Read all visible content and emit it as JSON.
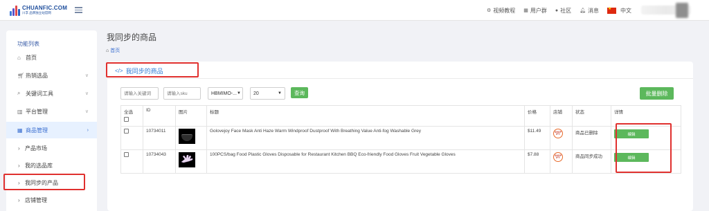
{
  "topbar": {
    "logo_name": "CHUANFIC.COM",
    "logo_tagline": "川孚 品牌独立站官网",
    "links": [
      {
        "label": "视频教程",
        "icon": "settings-icon"
      },
      {
        "label": "用户群",
        "icon": "grid-icon"
      },
      {
        "label": "社区",
        "icon": "user-icon"
      },
      {
        "label": "消息",
        "icon": "bell-icon"
      }
    ],
    "language": "中文"
  },
  "sidebar": {
    "title": "功能列表",
    "items": [
      {
        "label": "首页",
        "icon": "home-icon"
      },
      {
        "label": "热销选品",
        "icon": "cart-icon"
      },
      {
        "label": "关键词工具",
        "icon": "search-icon"
      },
      {
        "label": "平台管理",
        "icon": "building-icon"
      },
      {
        "label": "商品管理",
        "icon": "table-icon"
      }
    ],
    "subitems": [
      {
        "label": "产品市场"
      },
      {
        "label": "我的选品库"
      },
      {
        "label": "我同步的产品"
      },
      {
        "label": "店铺管理"
      }
    ]
  },
  "main": {
    "page_title": "我同步的商品",
    "breadcrumb": "首页",
    "card_title": "我同步的商品",
    "filters": {
      "keyword_placeholder": "请输入关键词",
      "sku_placeholder": "请输入sku",
      "store_value": "HBMIMO-...",
      "page_size": "20",
      "search_label": "查询",
      "bulk_delete_label": "批量删除"
    },
    "table": {
      "headers": {
        "select_all": "全选",
        "id": "ID",
        "image": "图片",
        "title": "标题",
        "price": "价格",
        "store": "店铺",
        "status": "状态",
        "details": "详情"
      },
      "rows": [
        {
          "id": "10734011",
          "title": "Golovejoy Face Mask Anti Haze Warm Windproof Dustproof With Breathing Value Anti-fog Washable Grey",
          "price": "$11.49",
          "status": "商品已删除",
          "edit_label": "编辑",
          "image_icon": "face-mask-image"
        },
        {
          "id": "10734043",
          "title": "100PCS/bag Food Plastic Gloves Disposable for Restaurant Kitchen BBQ Eco-friendly Food Gloves Fruit Vegetable Gloves",
          "price": "$7.88",
          "status": "商品同步成功",
          "edit_label": "编辑",
          "image_icon": "gloves-image"
        }
      ]
    }
  },
  "colors": {
    "accent_blue": "#3b6fd0",
    "button_green": "#5cb85c",
    "highlight_red": "#e0302e"
  }
}
